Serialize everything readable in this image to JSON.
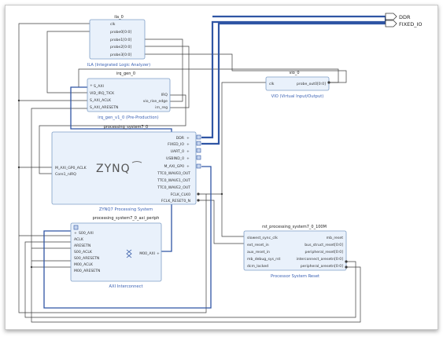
{
  "external_ports": {
    "ddr": "DDR",
    "fixed_io": "FIXED_IO"
  },
  "ila": {
    "name": "ila_0",
    "pins": [
      "clk",
      "probe0[0:0]",
      "probe1[0:0]",
      "probe2[0:0]",
      "probe3[0:0]"
    ],
    "caption": "ILA (Integrated Logic Analyzer)"
  },
  "irq_gen": {
    "name": "irq_gen_0",
    "left_pins": [
      "S_AXI",
      "VID_IRQ_TICK",
      "S_AXI_ACLK",
      "S_AXI_ARESETN"
    ],
    "right_pins": [
      "IRQ",
      "vio_rise_edge",
      "irn_reg"
    ],
    "caption": "irq_gen_v1_0 (Pre-Production)"
  },
  "vio": {
    "name": "vio_0",
    "left_pins": [
      "clk"
    ],
    "right_pins": [
      "probe_out0[0:0]"
    ],
    "caption": "VIO (Virtual Input/Output)"
  },
  "ps7": {
    "name": "processing_system7_0",
    "left_pins": [
      "M_AXI_GP0_ACLK",
      "Core1_nIRQ"
    ],
    "right_pins": [
      "DDR",
      "FIXED_IO",
      "UART_0",
      "USBIND_0",
      "M_AXI_GP0",
      "TTC0_WAVE0_OUT",
      "TTC0_WAVE1_OUT",
      "TTC0_WAVE2_OUT",
      "FCLK_CLK0",
      "FCLK_RESET0_N"
    ],
    "logo": "ZYNQ",
    "caption": "ZYNQ7 Processing System"
  },
  "axi": {
    "name": "processing_system7_0_axi_periph",
    "left_pins": [
      "S00_AXI",
      "ACLK",
      "ARESETN",
      "S00_ACLK",
      "S00_ARESETN",
      "M00_ACLK",
      "M00_ARESETN"
    ],
    "right_pins": [
      "M00_AXI"
    ],
    "caption": "AXI Interconnect"
  },
  "rst": {
    "name": "rst_processing_system7_0_100M",
    "left_pins": [
      "slowest_sync_clk",
      "ext_reset_in",
      "aux_reset_in",
      "mb_debug_sys_rst",
      "dcm_locked"
    ],
    "right_pins": [
      "mb_reset",
      "bus_struct_reset[0:0]",
      "peripheral_reset[0:0]",
      "interconnect_aresetn[0:0]",
      "peripheral_aresetn[0:0]"
    ],
    "caption": "Processor System Reset"
  },
  "colors": {
    "block_fill": "#e9f1fb",
    "block_border": "#7f9fc6",
    "bus": "#2f55a4",
    "caption": "#3b62b4",
    "wire": "#3e3e3e"
  }
}
